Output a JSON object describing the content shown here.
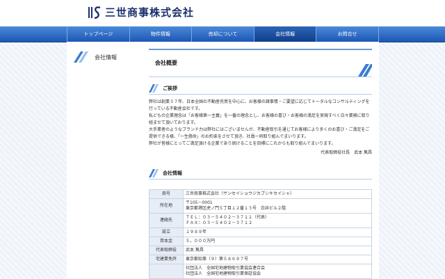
{
  "header": {
    "company_name": "三世商事株式会社"
  },
  "nav": {
    "items": [
      {
        "label": "トップページ"
      },
      {
        "label": "物件情報"
      },
      {
        "label": "売却について"
      },
      {
        "label": "会社情報"
      },
      {
        "label": "お問合せ"
      }
    ],
    "active_index": 3
  },
  "sidebar": {
    "title": "会社情報"
  },
  "page": {
    "title": "会社概要"
  },
  "greeting": {
    "heading": "ご挨拶",
    "paragraphs": [
      "弊社は創業３７年、日本全国の不動産売買を中心に、お客様の諸事情・ご要望に応じてトータルなコンサルティングを行っている不動産会社です。",
      "私どもの企業理念は「お客様第一主義」を一番の理念とし、お客様の喜び・お客様の満足を実現すべく日々業務に取り組ませて頂いております。",
      "大手業者のようなブランド力は弊社にはございませんが、不動産取引を通じてお客様により多くのお喜び・ご満足をご提供できる様、「一生懸命」のお約束をさせて頂き、社員一同取り組んでまいります。",
      "弊社が皆様にとってご満足頂ける企業であり続けることを目標にこれからも取り組んでまいります。"
    ],
    "signature": "代表取締役社長　武本 篤昌"
  },
  "company_info": {
    "heading": "会社情報",
    "rows": [
      {
        "label": "商号",
        "lines": [
          "三世商事株式会社（サンセイショウジカブシキカイシャ）"
        ]
      },
      {
        "label": "所在地",
        "lines": [
          "〒105－0001",
          "東京都港区虎ノ門５丁目１２番１３号　白井ビル２階"
        ]
      },
      {
        "label": "連絡先",
        "lines": [
          "ＴＥＬ：０３－５４０２－３７１１（代表）",
          "ＦＡＸ：０３－５４０２－３７１２"
        ]
      },
      {
        "label": "設立",
        "lines": [
          "１９８９年"
        ]
      },
      {
        "label": "資本金",
        "lines": [
          "５，０００万円"
        ]
      },
      {
        "label": "代表取締役",
        "lines": [
          "武本 篤昌"
        ]
      },
      {
        "label": "宅建業免許",
        "lines": [
          "東京都知事（９）第５８６９７号"
        ]
      },
      {
        "label": "",
        "lines": [
          "社団法人　全国宅地建物取引業協会連合会",
          "社団法人　全国宅地建物取引業保証協会"
        ]
      }
    ]
  },
  "colors": {
    "brand_blue": "#1a2f6b",
    "nav_blue": "#2d6fcf",
    "accent": "#4a86d4"
  }
}
